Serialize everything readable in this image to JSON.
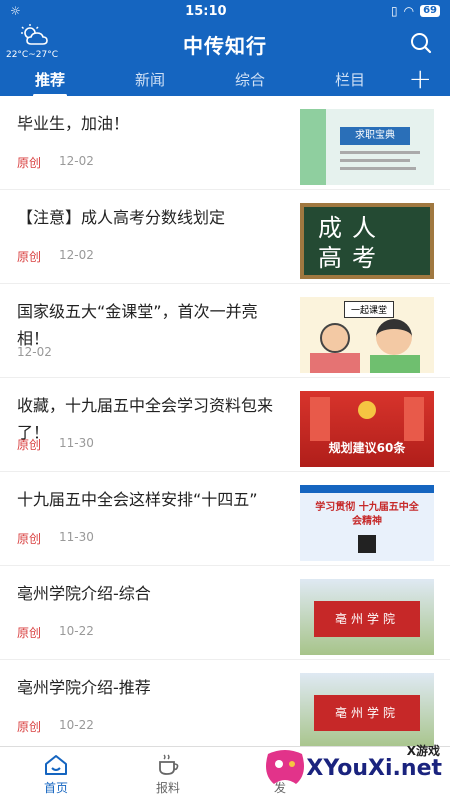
{
  "status": {
    "time": "15:10",
    "battery": "69"
  },
  "header": {
    "weather_temp": "22°C~27°C",
    "title": "中传知行"
  },
  "tabs": [
    {
      "label": "推荐",
      "active": true
    },
    {
      "label": "新闻",
      "active": false
    },
    {
      "label": "综合",
      "active": false
    },
    {
      "label": "栏目",
      "active": false
    }
  ],
  "articles": [
    {
      "title": "毕业生，加油！",
      "source": "原创",
      "date": "12-02",
      "thumb_text": "求职宝典"
    },
    {
      "title": "【注意】成人高考分数线划定",
      "source": "原创",
      "date": "12-02",
      "thumb_text": "成人高考"
    },
    {
      "title": "国家级五大“金课堂”，首次一并亮相！",
      "source": "",
      "date": "12-02",
      "thumb_text": "一起课堂"
    },
    {
      "title": "收藏，十九届五中全会学习资料包来了！",
      "source": "原创",
      "date": "11-30",
      "thumb_text": "规划建议60条"
    },
    {
      "title": "十九届五中全会这样安排“十四五”",
      "source": "原创",
      "date": "11-30",
      "thumb_text": "学习贯彻 十九届五中全会精神"
    },
    {
      "title": "亳州学院介绍-综合",
      "source": "原创",
      "date": "10-22",
      "thumb_text": "亳州学院"
    },
    {
      "title": "亳州学院介绍-推荐",
      "source": "原创",
      "date": "10-22",
      "thumb_text": "亳州学院"
    }
  ],
  "tabbar": [
    {
      "label": "首页",
      "icon": "home-icon",
      "active": true
    },
    {
      "label": "报料",
      "icon": "coffee-icon",
      "active": false
    },
    {
      "label": "发",
      "icon": "send-icon",
      "active": false
    }
  ],
  "watermark": {
    "brand": "XYouXi.net",
    "cn": "X游戏"
  },
  "colors": {
    "primary": "#1565c0",
    "source": "#d94040"
  }
}
